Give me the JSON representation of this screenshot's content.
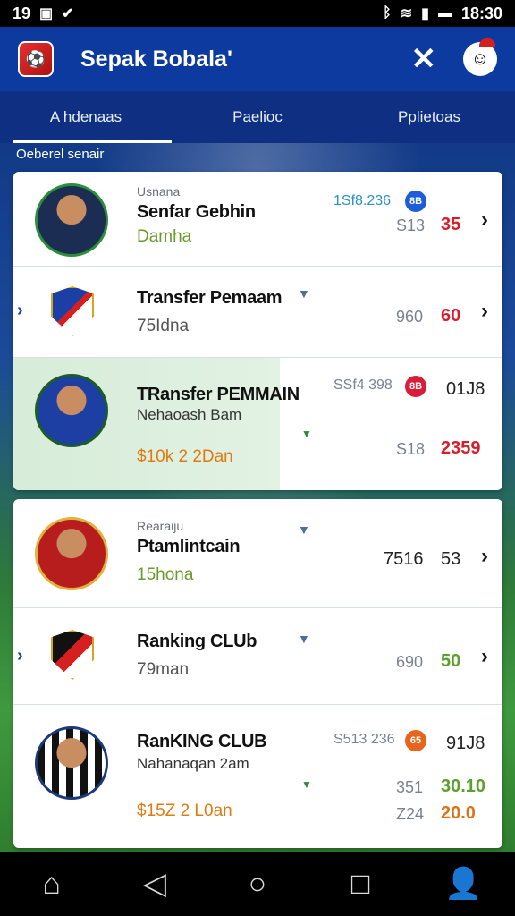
{
  "status_bar": {
    "time_left": "19",
    "time_right": "18:30"
  },
  "app_bar": {
    "title": "Sepak Bobala'",
    "close_glyph": "✕"
  },
  "tabs": [
    {
      "label": "A hdenaas",
      "active": true
    },
    {
      "label": "Paelioc",
      "active": false
    },
    {
      "label": "Pplietoas",
      "active": false
    }
  ],
  "section_label": "Oeberel senair",
  "rows": [
    {
      "kicker": "Usnana",
      "name": "Senfar Gebhin",
      "sub": "Damha",
      "numA": "1Sf8.236",
      "badge": "8B",
      "numA2": "S13",
      "numB": "35"
    },
    {
      "name": "Transfer Pemaam",
      "sub": "75Idna",
      "numA": "960",
      "numB": "60"
    },
    {
      "name": "TRansfer PEMMAIN",
      "sub": "Nehaoash Bam",
      "fee": "$10k 2 2Dan",
      "numA": "SSf4 398",
      "badge": "8B",
      "numB": "01J8",
      "numA2": "S18",
      "numB2": "2359"
    },
    {
      "kicker": "Rearaiju",
      "name": "Ptamlintcain",
      "sub": "15hona",
      "numA": "7516",
      "numB": "53"
    },
    {
      "name": "Ranking CLUb",
      "sub": "79man",
      "numA": "690",
      "numB": "50"
    },
    {
      "name": "RanKING CLUB",
      "sub": "Nahanaqan 2am",
      "fee": "$15Z 2 L0an",
      "numA": "S513 236",
      "badge": "65",
      "numB": "91J8",
      "numA2": "351",
      "numB2": "30.10",
      "numA3": "Z24",
      "numB3": "20.0"
    }
  ],
  "nav": {
    "home": "⌂",
    "back": "◁",
    "circle": "○",
    "recent": "□",
    "profile": "👤"
  }
}
